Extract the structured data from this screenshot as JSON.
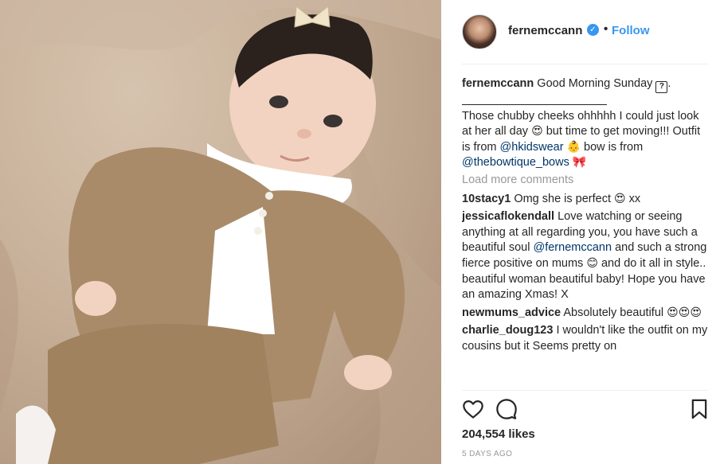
{
  "post": {
    "image_alt": "Baby in knitted cardigan and shorts with a bow",
    "author": {
      "username": "fernemccann",
      "verified_icon": "verified-badge-icon",
      "separator": "•",
      "follow_label": "Follow"
    },
    "caption": {
      "username": "fernemccann",
      "line1": "Good Morning Sunday",
      "line1_icon": "?",
      "line1_end": ".",
      "body_part1": "Those chubby cheeks ohhhhh I could just look at her all day",
      "body_emoji1": "😍",
      "body_part2": "but time to get moving!!! Outfit is from",
      "mention1": "@hkidswear",
      "body_emoji2": "👶",
      "body_part3": "bow is from",
      "mention2": "@thebowtique_bows",
      "body_emoji3": "🎀"
    },
    "load_more_label": "Load more comments",
    "comments": [
      {
        "user": "10stacy1",
        "text": "Omg she is perfect",
        "emoji": "😍",
        "tail": "xx"
      },
      {
        "user": "jessicaflokendall",
        "text": "Love watching or seeing anything at all regarding you, you have such a beautiful soul",
        "mention": "@fernemccann",
        "text2": "and such a strong fierce positive on mums",
        "emoji": "😊",
        "text3": "and do it all in style.. beautiful woman beautiful baby! Hope you have an amazing Xmas! X"
      },
      {
        "user": "newmums_advice",
        "text": "Absolutely beautiful",
        "emoji": "😍😍😍"
      },
      {
        "user": "charlie_doug123",
        "text": "I wouldn't like the outfit on my cousins but it Seems pretty on"
      }
    ],
    "actions": {
      "like_icon": "heart-icon",
      "comment_icon": "comment-icon",
      "save_icon": "bookmark-icon"
    },
    "likes_label": "204,554 likes",
    "timestamp": "5 DAYS AGO"
  }
}
